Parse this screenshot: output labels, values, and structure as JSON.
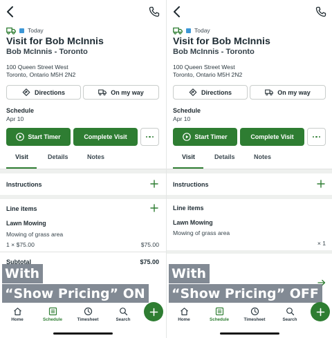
{
  "colors": {
    "accent": "#2e7d32",
    "today_marker": "#3d97d6",
    "overlay": "#5f6976"
  },
  "icons": {
    "back": "chevron-left-icon",
    "phone": "phone-icon",
    "truck": "truck-icon",
    "directions": "directions-icon",
    "on_my_way": "truck-icon",
    "play": "play-circle-icon",
    "more": "more-dots-icon",
    "add": "plus-icon",
    "arrow": "arrow-right-icon",
    "home": "home-icon",
    "schedule": "calendar-list-icon",
    "timesheet": "clock-icon",
    "search": "search-icon"
  },
  "panels": [
    {
      "today_label": "Today",
      "title": "Visit for Bob McInnis",
      "subtitle": "Bob McInnis - Toronto",
      "address_line1": "100 Queen Street West",
      "address_line2": "Toronto, Ontario M5H 2N2",
      "directions_label": "Directions",
      "on_my_way_label": "On my way",
      "schedule_label": "Schedule",
      "schedule_date": "Apr 10",
      "start_timer_label": "Start Timer",
      "complete_visit_label": "Complete Visit",
      "tabs": [
        {
          "label": "Visit"
        },
        {
          "label": "Details"
        },
        {
          "label": "Notes"
        }
      ],
      "instructions_label": "Instructions",
      "line_items_label": "Line items",
      "item_name": "Lawn Mowing",
      "item_desc": "Mowing of grass area",
      "item_qty": "1 × $75.00",
      "item_total": "$75.00",
      "subtotal_label": "Subtotal",
      "subtotal_amount": "$75.00",
      "overlay_line1": "With",
      "overlay_line2": "“Show Pricing” ON",
      "nav": [
        {
          "label": "Home"
        },
        {
          "label": "Schedule"
        },
        {
          "label": "Timesheet"
        },
        {
          "label": "Search"
        }
      ]
    },
    {
      "today_label": "Today",
      "title": "Visit for Bob McInnis",
      "subtitle": "Bob McInnis - Toronto",
      "address_line1": "100 Queen Street West",
      "address_line2": "Toronto, Ontario M5H 2N2",
      "directions_label": "Directions",
      "on_my_way_label": "On my way",
      "schedule_label": "Schedule",
      "schedule_date": "Apr 10",
      "start_timer_label": "Start Timer",
      "complete_visit_label": "Complete Visit",
      "tabs": [
        {
          "label": "Visit"
        },
        {
          "label": "Details"
        },
        {
          "label": "Notes"
        }
      ],
      "instructions_label": "Instructions",
      "line_items_label": "Line items",
      "item_name": "Lawn Mowing",
      "item_desc": "Mowing of grass area",
      "item_qty": "× 1",
      "overlay_line1": "With",
      "overlay_line2": "“Show Pricing” OFF",
      "nav": [
        {
          "label": "Home"
        },
        {
          "label": "Schedule"
        },
        {
          "label": "Timesheet"
        },
        {
          "label": "Search"
        }
      ]
    }
  ]
}
